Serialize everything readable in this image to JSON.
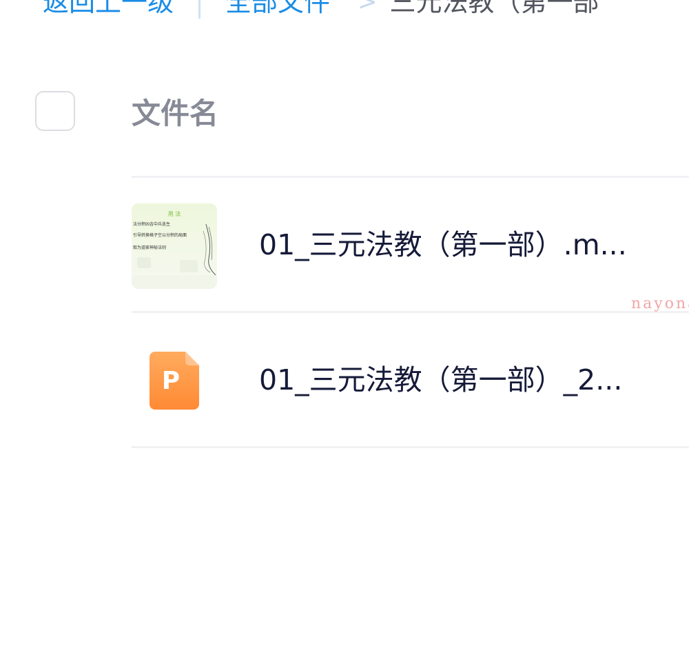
{
  "breadcrumb": {
    "back_label": "返回上一级",
    "all_files_label": "全部文件",
    "current_label": "三元法教（第一部"
  },
  "header": {
    "filename_column": "文件名"
  },
  "files": [
    {
      "name": "01_三元法教（第一部）.m...",
      "thumbnail": "document-page-thumbnail",
      "thumb_text": {
        "title": "用 法",
        "line1": "法分积凶吉中兵迭生",
        "line2": "引导转换格子空以分积的局面",
        "line3": "取为道家神秘法则"
      }
    },
    {
      "name": "01_三元法教（第一部）_2...",
      "icon": "ppt-file-icon",
      "icon_letter": "P",
      "icon_color": "#ff8f3a"
    }
  ],
  "watermark": "nayona",
  "colors": {
    "link": "#1a8ce6",
    "header_text": "#878a96",
    "file_text": "#161a38",
    "divider": "#f1f2f4",
    "ppt_orange": "#ff8f3a",
    "watermark": "#f0a6a6"
  }
}
